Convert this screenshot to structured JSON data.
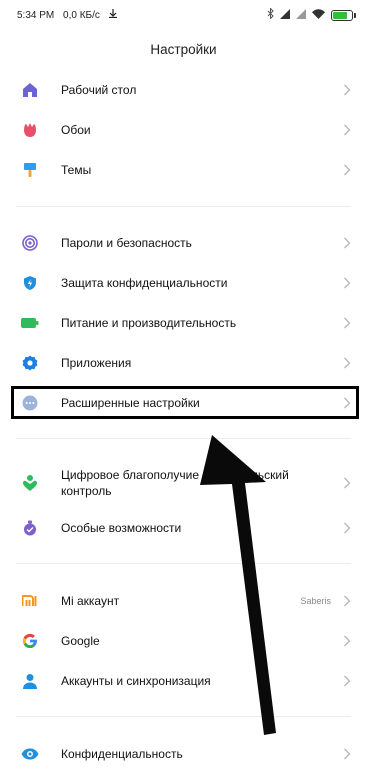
{
  "status_bar": {
    "time": "5:34 PM",
    "speed": "0,0 КБ/с",
    "battery_level": 0.8,
    "icons": [
      "bluetooth-icon",
      "signal-icon",
      "signal-icon",
      "wifi-icon",
      "battery-icon"
    ]
  },
  "header": {
    "title": "Настройки"
  },
  "groups": [
    {
      "items": [
        {
          "label": "Рабочий стол",
          "icon": "home-icon",
          "color": "#6c63d9"
        },
        {
          "label": "Обои",
          "icon": "tulip-icon",
          "color": "#ea4f6a"
        },
        {
          "label": "Темы",
          "icon": "brush-icon",
          "color": "#2a9df4"
        }
      ]
    },
    {
      "items": [
        {
          "label": "Пароли и безопасность",
          "icon": "fingerprint-icon",
          "color": "#7b61c9"
        },
        {
          "label": "Защита конфиденциальности",
          "icon": "shield-icon",
          "color": "#1f8fe0"
        },
        {
          "label": "Питание и производительность",
          "icon": "battery-icon",
          "color": "#2dbb5b"
        },
        {
          "label": "Приложения",
          "icon": "gear-icon",
          "color": "#1f7fe0"
        },
        {
          "label": "Расширенные настройки",
          "icon": "more-dots-icon",
          "color": "#9fb3d9"
        }
      ]
    },
    {
      "items": [
        {
          "label_line1": "Цифровое благополучие и родительский",
          "label_line2": "контроль",
          "icon": "wellbeing-icon",
          "color": "#2dbb5b"
        },
        {
          "label": "Особые возможности",
          "icon": "accessibility-icon",
          "color": "#7b61c9"
        }
      ]
    },
    {
      "items": [
        {
          "label": "Mi аккаунт",
          "icon": "mi-icon",
          "color": "#f39a1d",
          "value": "Saberis"
        },
        {
          "label": "Google",
          "icon": "google-icon",
          "color": "#4285f4"
        },
        {
          "label": "Аккаунты и синхронизация",
          "icon": "person-icon",
          "color": "#1f8fe0"
        }
      ]
    },
    {
      "items": [
        {
          "label": "Конфиденциальность",
          "icon": "eye-icon",
          "color": "#1f8fe0"
        }
      ]
    }
  ],
  "annotation": {
    "highlighted_item": "Расширенные настройки"
  }
}
